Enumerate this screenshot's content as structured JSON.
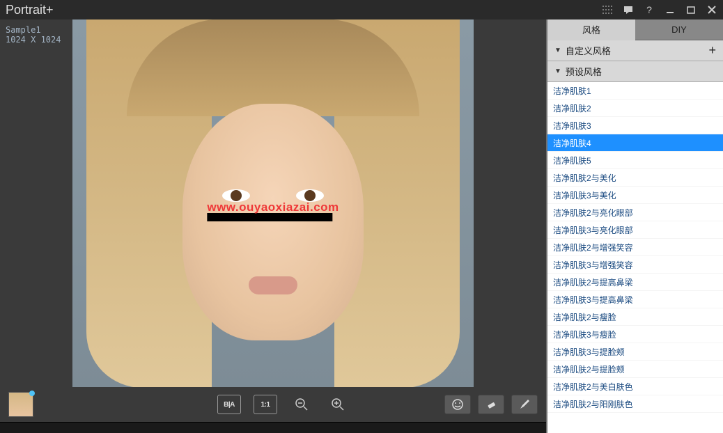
{
  "titlebar": {
    "title": "Portrait+"
  },
  "imageInfo": {
    "name": "Sample1",
    "dimensions": "1024 X 1024"
  },
  "watermark": {
    "text": "www.ouyaoxiazai.com"
  },
  "toolbar": {
    "compare": "B|A",
    "oneToOne": "1:1"
  },
  "rightPanel": {
    "tabs": {
      "style": "风格",
      "diy": "DIY"
    },
    "sections": {
      "custom": "自定义风格",
      "preset": "预设风格"
    },
    "presets": [
      "洁净肌肤1",
      "洁净肌肤2",
      "洁净肌肤3",
      "洁净肌肤4",
      "洁净肌肤5",
      "洁净肌肤2与美化",
      "洁净肌肤3与美化",
      "洁净肌肤2与亮化眼部",
      "洁净肌肤3与亮化眼部",
      "洁净肌肤2与增强笑容",
      "洁净肌肤3与增强笑容",
      "洁净肌肤2与提高鼻梁",
      "洁净肌肤3与提高鼻梁",
      "洁净肌肤2与瘦脸",
      "洁净肌肤3与瘦脸",
      "洁净肌肤3与提脸颊",
      "洁净肌肤2与提脸颊",
      "洁净肌肤2与美白肤色",
      "洁净肌肤2与阳刚肤色"
    ],
    "selectedIndex": 3
  }
}
